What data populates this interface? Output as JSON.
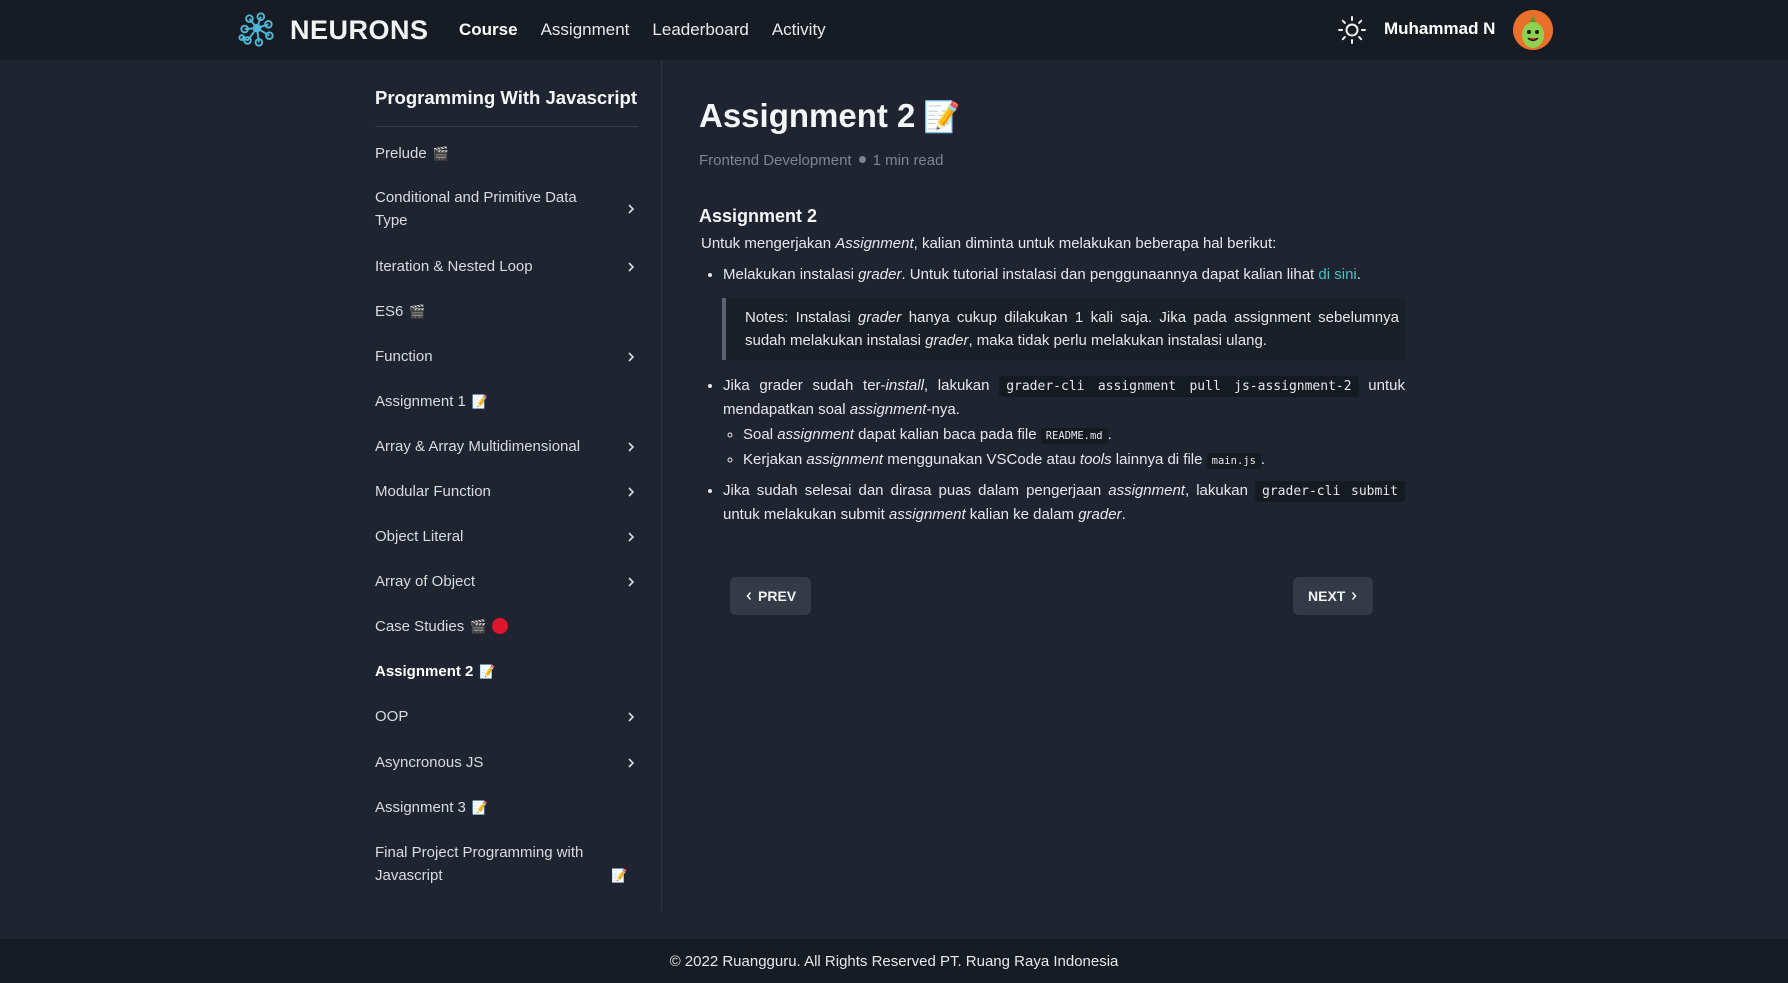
{
  "header": {
    "brand": "NEURONS",
    "nav": [
      "Course",
      "Assignment",
      "Leaderboard",
      "Activity"
    ],
    "user_name": "Muhammad N",
    "theme_icon": "sun-icon"
  },
  "sidebar": {
    "course_title": "Programming With Javascript",
    "items": [
      {
        "label": "Prelude",
        "icon": "clapper-icon",
        "emoji": "🎬",
        "expandable": false
      },
      {
        "label": "Conditional and Primitive Data Type",
        "expandable": true
      },
      {
        "label": "Iteration & Nested Loop",
        "expandable": true
      },
      {
        "label": "ES6",
        "icon": "clapper-icon",
        "emoji": "🎬",
        "expandable": false
      },
      {
        "label": "Function",
        "expandable": true
      },
      {
        "label": "Assignment 1",
        "icon": "memo-icon",
        "emoji": "📝",
        "expandable": false
      },
      {
        "label": "Array & Array Multidimensional",
        "expandable": true
      },
      {
        "label": "Modular Function",
        "expandable": true
      },
      {
        "label": "Object Literal",
        "expandable": true
      },
      {
        "label": "Array of Object",
        "expandable": true
      },
      {
        "label": "Case Studies",
        "icon": "clapper-icon",
        "emoji": "🎬",
        "status": "red-dot",
        "expandable": false
      },
      {
        "label": "Assignment 2",
        "icon": "memo-icon",
        "emoji": "📝",
        "expandable": false,
        "active": true
      },
      {
        "label": "OOP",
        "expandable": true
      },
      {
        "label": "Asyncronous JS",
        "expandable": true
      },
      {
        "label": "Assignment 3",
        "icon": "memo-icon",
        "emoji": "📝",
        "expandable": false
      },
      {
        "label": "Final Project Programming with Javascript",
        "icon": "memo-icon",
        "emoji": "📝",
        "expandable": false
      }
    ]
  },
  "main": {
    "title": "Assignment 2",
    "title_emoji": "📝",
    "category": "Frontend Development",
    "read_time": "1 min read",
    "section_heading": "Assignment 2",
    "intro": {
      "a": "Untuk mengerjakan ",
      "b": "Assignment",
      "c": ", kalian diminta untuk melakukan beberapa hal berikut:"
    },
    "bullet1": {
      "a": "Melakukan instalasi ",
      "b": "grader",
      "c": ". Untuk tutorial instalasi dan penggunaannya dapat kalian lihat ",
      "link": "di sini",
      "d": "."
    },
    "notes": {
      "a": "Notes: Instalasi ",
      "b": "grader",
      "c": " hanya cukup dilakukan 1 kali saja. Jika pada assignment sebelumnya sudah melakukan instalasi ",
      "d": "grader",
      "e": ", maka tidak perlu melakukan instalasi ulang."
    },
    "bullet2": {
      "a": "Jika grader sudah ter-",
      "b": "install",
      "c": ", lakukan ",
      "code": "grader-cli assignment pull js-assignment-2",
      "d": " untuk mendapatkan soal ",
      "e": "assignment",
      "f": "-nya."
    },
    "sub1": {
      "a": "Soal ",
      "b": "assignment",
      "c": " dapat kalian baca pada file ",
      "code": "README.md",
      "d": "."
    },
    "sub2": {
      "a": "Kerjakan ",
      "b": "assignment",
      "c": " menggunakan VSCode atau ",
      "d": "tools",
      "e": " lainnya di file ",
      "code": "main.js",
      "f": "."
    },
    "bullet3": {
      "a": "Jika sudah selesai dan dirasa puas dalam pengerjaan ",
      "b": "assignment",
      "c": ", lakukan ",
      "code": "grader-cli submit",
      "d": " untuk melakukan submit ",
      "e": "assignment",
      "f": " kalian ke dalam ",
      "g": "grader",
      "h": "."
    },
    "prev_label": "PREV",
    "next_label": "NEXT"
  },
  "footer": {
    "text": "© 2022 Ruangguru. All Rights Reserved PT. Ruang Raya Indonesia"
  }
}
